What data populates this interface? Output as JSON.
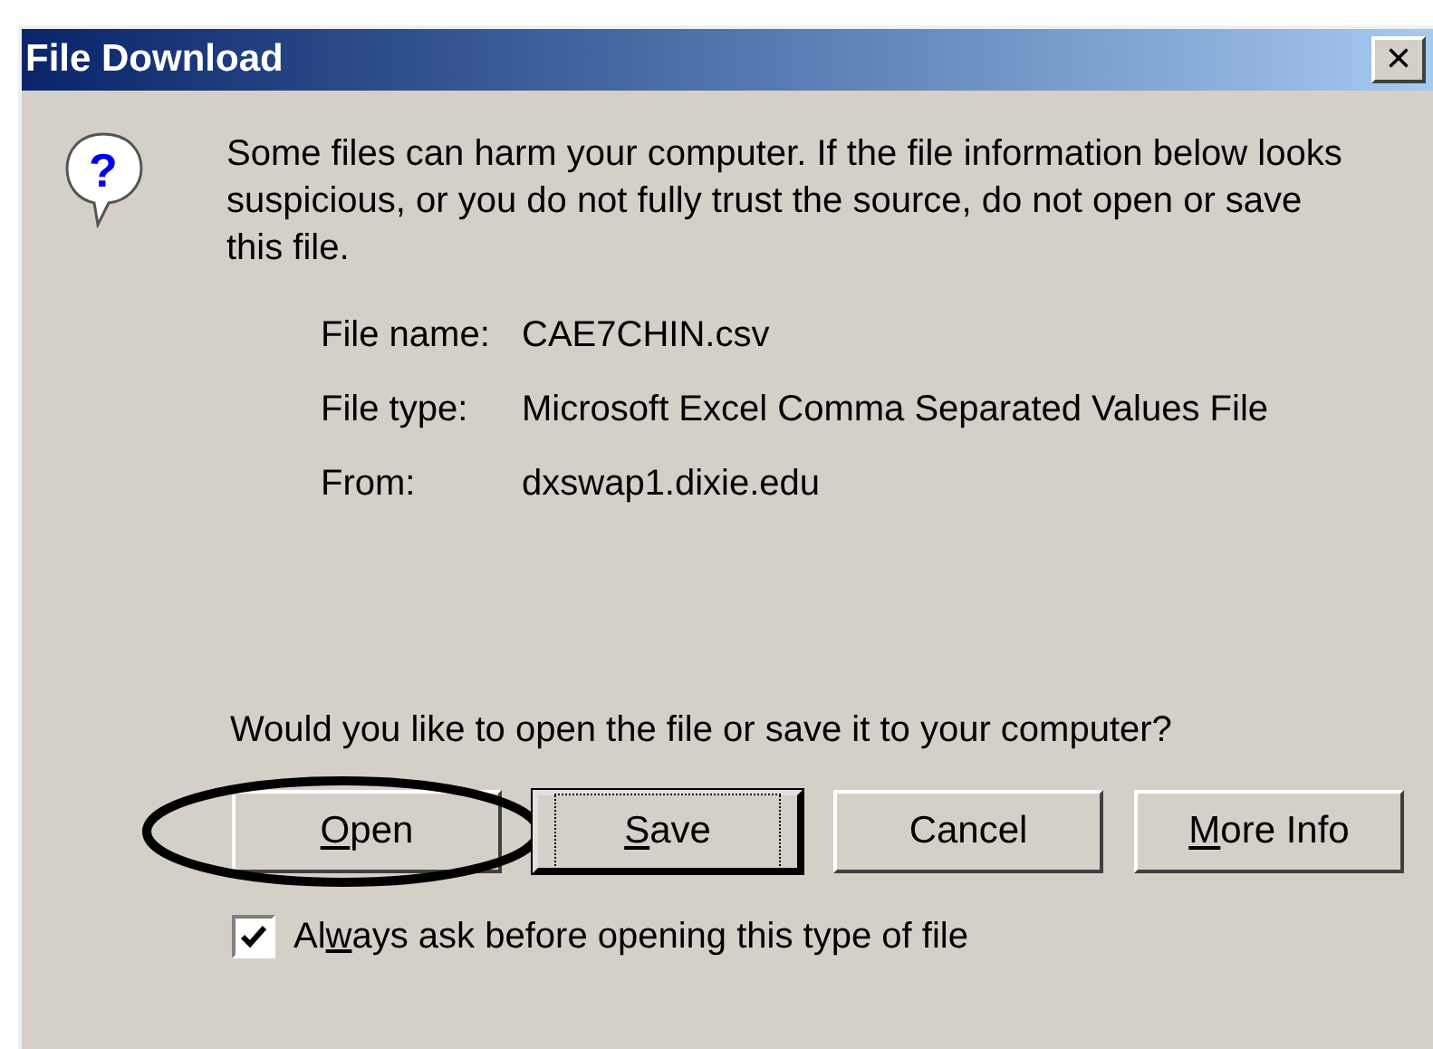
{
  "window": {
    "title": "File Download",
    "close": "×"
  },
  "icon_glyph": "?",
  "message": "Some files can harm your computer. If the file information below looks suspicious, or you do not fully trust the source, do not open or save this file.",
  "fields": [
    {
      "label": "File name:",
      "value": "CAE7CHIN.csv"
    },
    {
      "label": "File type:",
      "value": "Microsoft Excel Comma Separated Values File"
    },
    {
      "label": "From:",
      "value": "dxswap1.dixie.edu"
    }
  ],
  "question": "Would you like to open the file or save it to your computer?",
  "buttons": [
    {
      "key": "O",
      "after": "pen",
      "default": false,
      "circled": true
    },
    {
      "key": "S",
      "after": "ave",
      "default": true,
      "circled": false
    },
    {
      "before": "Cancel",
      "default": false,
      "circled": false
    },
    {
      "key": "M",
      "after": "ore Info",
      "default": false,
      "circled": false
    }
  ],
  "checkbox": {
    "before": "Al",
    "key": "w",
    "after": "ays ask before opening this type of file",
    "checked": true
  }
}
